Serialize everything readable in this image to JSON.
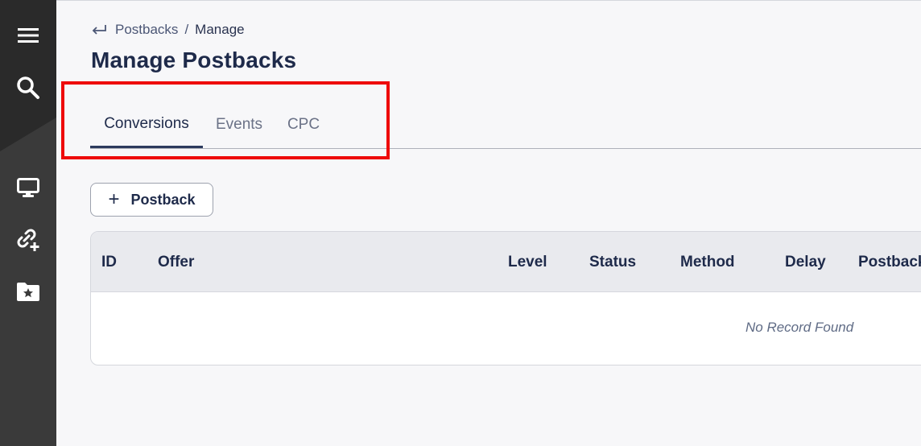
{
  "sidebar": {
    "items": [
      {
        "icon": "menu-icon"
      },
      {
        "icon": "search-icon"
      },
      {
        "icon": "monitor-icon"
      },
      {
        "icon": "link-add-icon"
      },
      {
        "icon": "folder-star-icon"
      }
    ]
  },
  "breadcrumb": {
    "back_icon": "arrow-return-icon",
    "parent": "Postbacks",
    "separator": "/",
    "current": "Manage"
  },
  "page": {
    "title": "Manage Postbacks"
  },
  "tabs": [
    {
      "label": "Conversions",
      "active": true
    },
    {
      "label": "Events",
      "active": false
    },
    {
      "label": "CPC",
      "active": false
    }
  ],
  "toolbar": {
    "add_icon": "+",
    "add_label": "Postback"
  },
  "table": {
    "columns": [
      "ID",
      "Offer",
      "Level",
      "Status",
      "Method",
      "Delay",
      "Postback"
    ],
    "rows": [],
    "empty_message": "No Record Found"
  },
  "colors": {
    "sidebar": "#3a3a3a",
    "sidebar_dark": "#2a2a2a",
    "highlight": "#ee0a0a",
    "title": "#1e2a4a"
  }
}
